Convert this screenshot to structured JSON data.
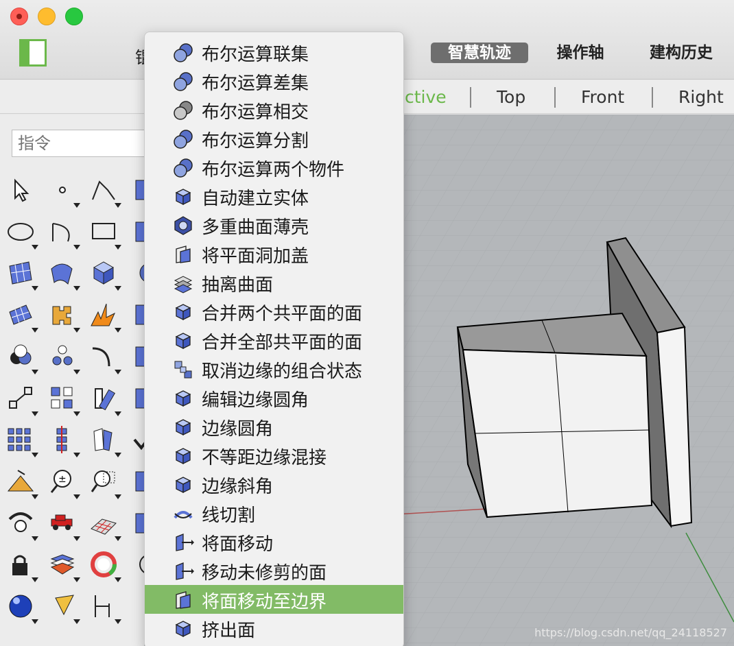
{
  "window": {
    "hidden_tab_fragment": "锟",
    "tabs": [
      {
        "label": "智慧轨迹",
        "active": true
      },
      {
        "label": "操作轴",
        "active": false
      },
      {
        "label": "建构历史",
        "active": false
      }
    ]
  },
  "viewport_tabs": {
    "perspective_fragment": "ctive",
    "items": [
      "Top",
      "Front",
      "Right"
    ]
  },
  "command": {
    "placeholder": "指令"
  },
  "menu": {
    "items": [
      {
        "label": "布尔运算联集",
        "icon": "boolean-union-icon"
      },
      {
        "label": "布尔运算差集",
        "icon": "boolean-difference-icon"
      },
      {
        "label": "布尔运算相交",
        "icon": "boolean-intersection-icon"
      },
      {
        "label": "布尔运算分割",
        "icon": "boolean-split-icon"
      },
      {
        "label": "布尔运算两个物件",
        "icon": "boolean-two-objects-icon"
      },
      {
        "label": "自动建立实体",
        "icon": "create-solid-icon"
      },
      {
        "label": "多重曲面薄壳",
        "icon": "shell-icon"
      },
      {
        "label": "将平面洞加盖",
        "icon": "cap-icon"
      },
      {
        "label": "抽离曲面",
        "icon": "extract-surface-icon"
      },
      {
        "label": "合并两个共平面的面",
        "icon": "merge-two-faces-icon"
      },
      {
        "label": "合并全部共平面的面",
        "icon": "merge-all-faces-icon"
      },
      {
        "label": "取消边缘的组合状态",
        "icon": "unjoin-edge-icon"
      },
      {
        "label": "编辑边缘圆角",
        "icon": "edit-fillet-edge-icon"
      },
      {
        "label": "边缘圆角",
        "icon": "fillet-edge-icon"
      },
      {
        "label": "不等距边缘混接",
        "icon": "blend-edge-icon"
      },
      {
        "label": "边缘斜角",
        "icon": "chamfer-edge-icon"
      },
      {
        "label": "线切割",
        "icon": "wire-cut-icon"
      },
      {
        "label": "将面移动",
        "icon": "move-face-icon"
      },
      {
        "label": "移动未修剪的面",
        "icon": "move-untrimmed-face-icon"
      },
      {
        "label": "将面移动至边界",
        "icon": "move-face-to-boundary-icon",
        "highlighted": true
      },
      {
        "label": "挤出面",
        "icon": "extrude-face-icon"
      }
    ]
  },
  "colors": {
    "accent": "#6bb84a",
    "menu_highlight": "#82bb66",
    "active_tab": "#6e6e6e",
    "viewport_bg": "#b4b7ba"
  },
  "watermark": "https://blog.csdn.net/qq_24118527"
}
